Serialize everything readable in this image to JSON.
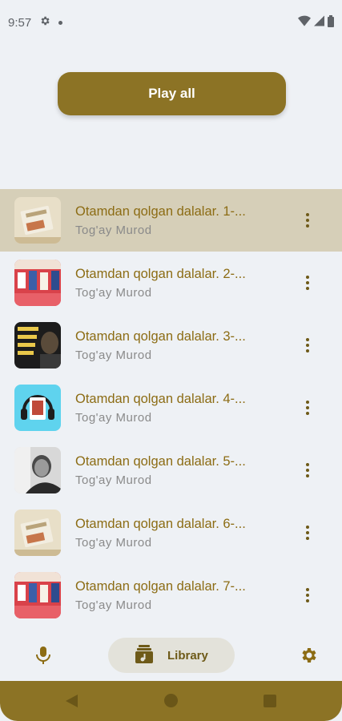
{
  "status": {
    "time": "9:57"
  },
  "play_all_label": "Play all",
  "tracks": [
    {
      "title": "Otamdan qolgan dalalar. 1-...",
      "artist": "Tog'ay Murod",
      "selected": true
    },
    {
      "title": "Otamdan qolgan dalalar. 2-...",
      "artist": "Tog'ay Murod"
    },
    {
      "title": "Otamdan qolgan dalalar. 3-...",
      "artist": "Tog'ay Murod"
    },
    {
      "title": "Otamdan qolgan dalalar. 4-...",
      "artist": "Tog'ay Murod"
    },
    {
      "title": "Otamdan qolgan dalalar. 5-...",
      "artist": "Tog'ay Murod"
    },
    {
      "title": "Otamdan qolgan dalalar. 6-...",
      "artist": "Tog'ay Murod"
    },
    {
      "title": "Otamdan qolgan dalalar. 7-...",
      "artist": "Tog'ay Murod"
    }
  ],
  "bottom_nav": {
    "library_label": "Library",
    "icons": [
      "mic-icon",
      "library-music-icon",
      "gear-icon"
    ]
  },
  "colors": {
    "accent": "#8C7325",
    "title_text": "#8C6C14",
    "selected_row": "#D6CFB8",
    "background": "#EEF1F5"
  }
}
